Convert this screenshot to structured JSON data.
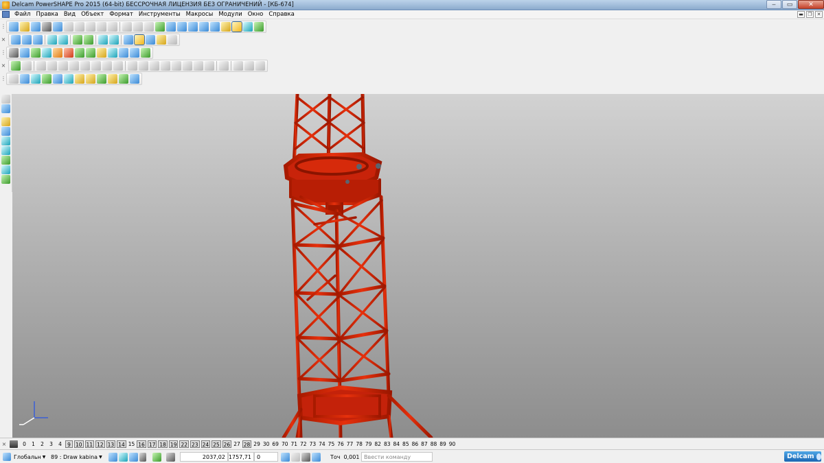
{
  "window": {
    "title": "Delcam PowerSHAPE Pro 2015 (64-bit) БЕССРОЧНАЯ ЛИЦЕНЗИЯ БЕЗ ОГРАНИЧЕНИЙ - [КБ-674]",
    "minimize": "‒",
    "maximize": "▭",
    "close": "✕"
  },
  "menu": {
    "items": [
      "Файл",
      "Правка",
      "Вид",
      "Объект",
      "Формат",
      "Инструменты",
      "Макросы",
      "Модули",
      "Окно",
      "Справка"
    ],
    "mdi_minimize": "▬",
    "mdi_restore": "❐",
    "mdi_close": "✕"
  },
  "toolbar_close": "×",
  "toolbar_grip": "⋮",
  "levels": {
    "close": "×",
    "items": [
      {
        "label": "0",
        "on": false
      },
      {
        "label": "1",
        "on": false
      },
      {
        "label": "2",
        "on": false
      },
      {
        "label": "3",
        "on": false
      },
      {
        "label": "4",
        "on": false
      },
      {
        "label": "9",
        "on": true
      },
      {
        "label": "10",
        "on": true
      },
      {
        "label": "11",
        "on": true
      },
      {
        "label": "12",
        "on": true
      },
      {
        "label": "13",
        "on": true
      },
      {
        "label": "14",
        "on": true
      },
      {
        "label": "15",
        "on": false
      },
      {
        "label": "16",
        "on": true
      },
      {
        "label": "17",
        "on": true
      },
      {
        "label": "18",
        "on": true
      },
      {
        "label": "19",
        "on": true
      },
      {
        "label": "22",
        "on": true
      },
      {
        "label": "23",
        "on": true
      },
      {
        "label": "24",
        "on": true
      },
      {
        "label": "25",
        "on": true
      },
      {
        "label": "26",
        "on": true
      },
      {
        "label": "27",
        "on": false
      },
      {
        "label": "28",
        "on": true
      },
      {
        "label": "29",
        "on": false
      },
      {
        "label": "30",
        "on": false
      },
      {
        "label": "69",
        "on": false
      },
      {
        "label": "70",
        "on": false
      },
      {
        "label": "71",
        "on": false
      },
      {
        "label": "72",
        "on": false
      },
      {
        "label": "73",
        "on": false
      },
      {
        "label": "74",
        "on": false
      },
      {
        "label": "75",
        "on": false
      },
      {
        "label": "76",
        "on": false
      },
      {
        "label": "77",
        "on": false
      },
      {
        "label": "78",
        "on": false
      },
      {
        "label": "79",
        "on": false
      },
      {
        "label": "82",
        "on": false
      },
      {
        "label": "83",
        "on": false
      },
      {
        "label": "84",
        "on": false
      },
      {
        "label": "85",
        "on": false
      },
      {
        "label": "86",
        "on": false
      },
      {
        "label": "87",
        "on": false
      },
      {
        "label": "88",
        "on": false
      },
      {
        "label": "89",
        "on": false
      },
      {
        "label": "90",
        "on": false
      }
    ]
  },
  "status": {
    "workplane": "Глобальн",
    "level": "89 : Draw kabina",
    "x": "2037,02",
    "y": "1757,71",
    "z": "0",
    "tolerance_label": "Точ",
    "tolerance": "0,001",
    "command_placeholder": "Ввести команду",
    "brand": "Delcam"
  }
}
